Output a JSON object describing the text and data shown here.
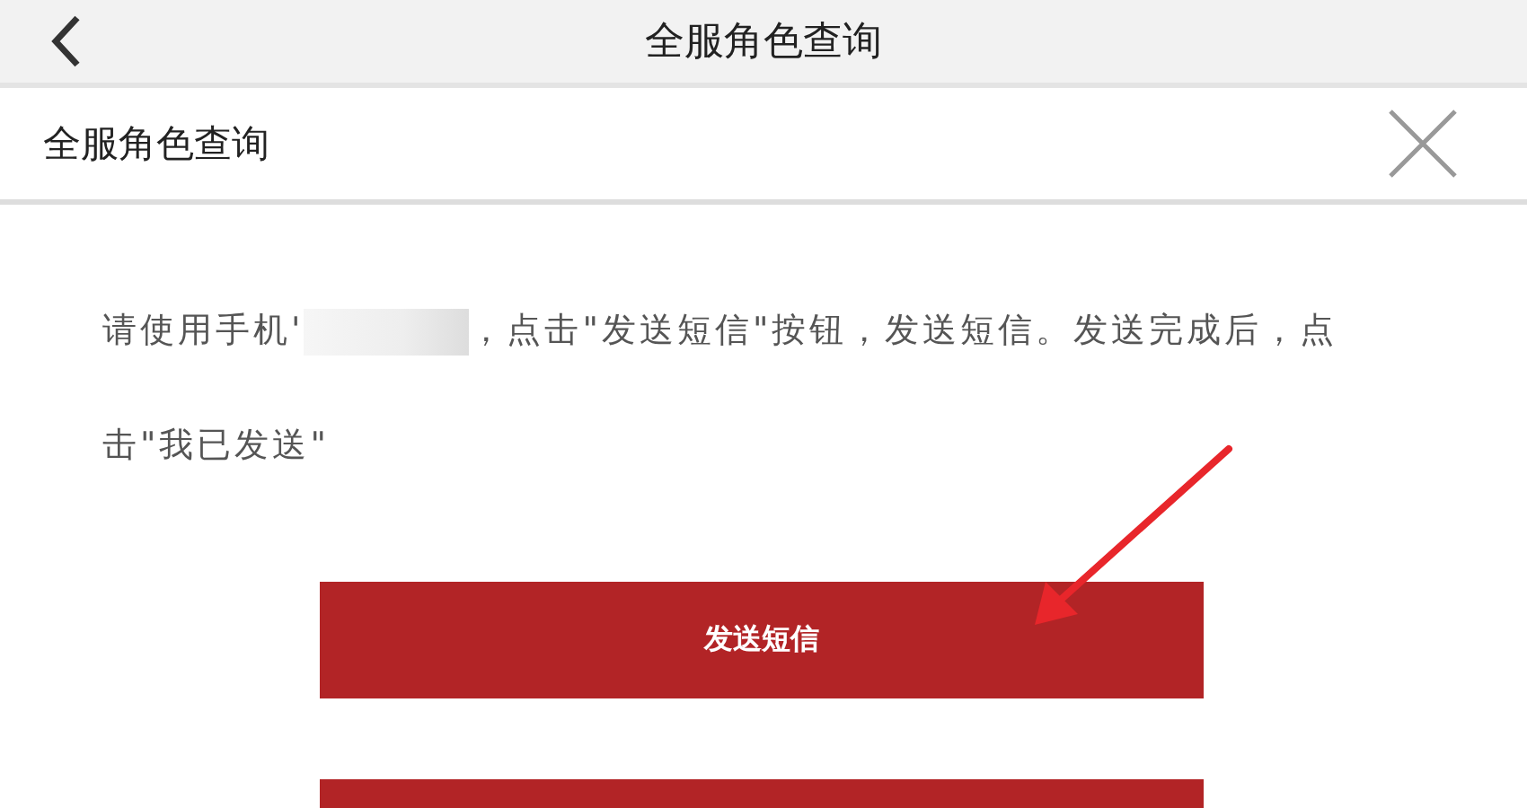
{
  "top_bar": {
    "title": "全服角色查询"
  },
  "panel": {
    "title": "全服角色查询",
    "instruction_before": "请使用手机'",
    "instruction_after": "，点击\"发送短信\"按钮，发送短信。发送完成后，点击\"我已发送\""
  },
  "buttons": [
    {
      "kind": "labeled",
      "label": "发送短信"
    },
    {
      "kind": "cut-off"
    }
  ]
}
